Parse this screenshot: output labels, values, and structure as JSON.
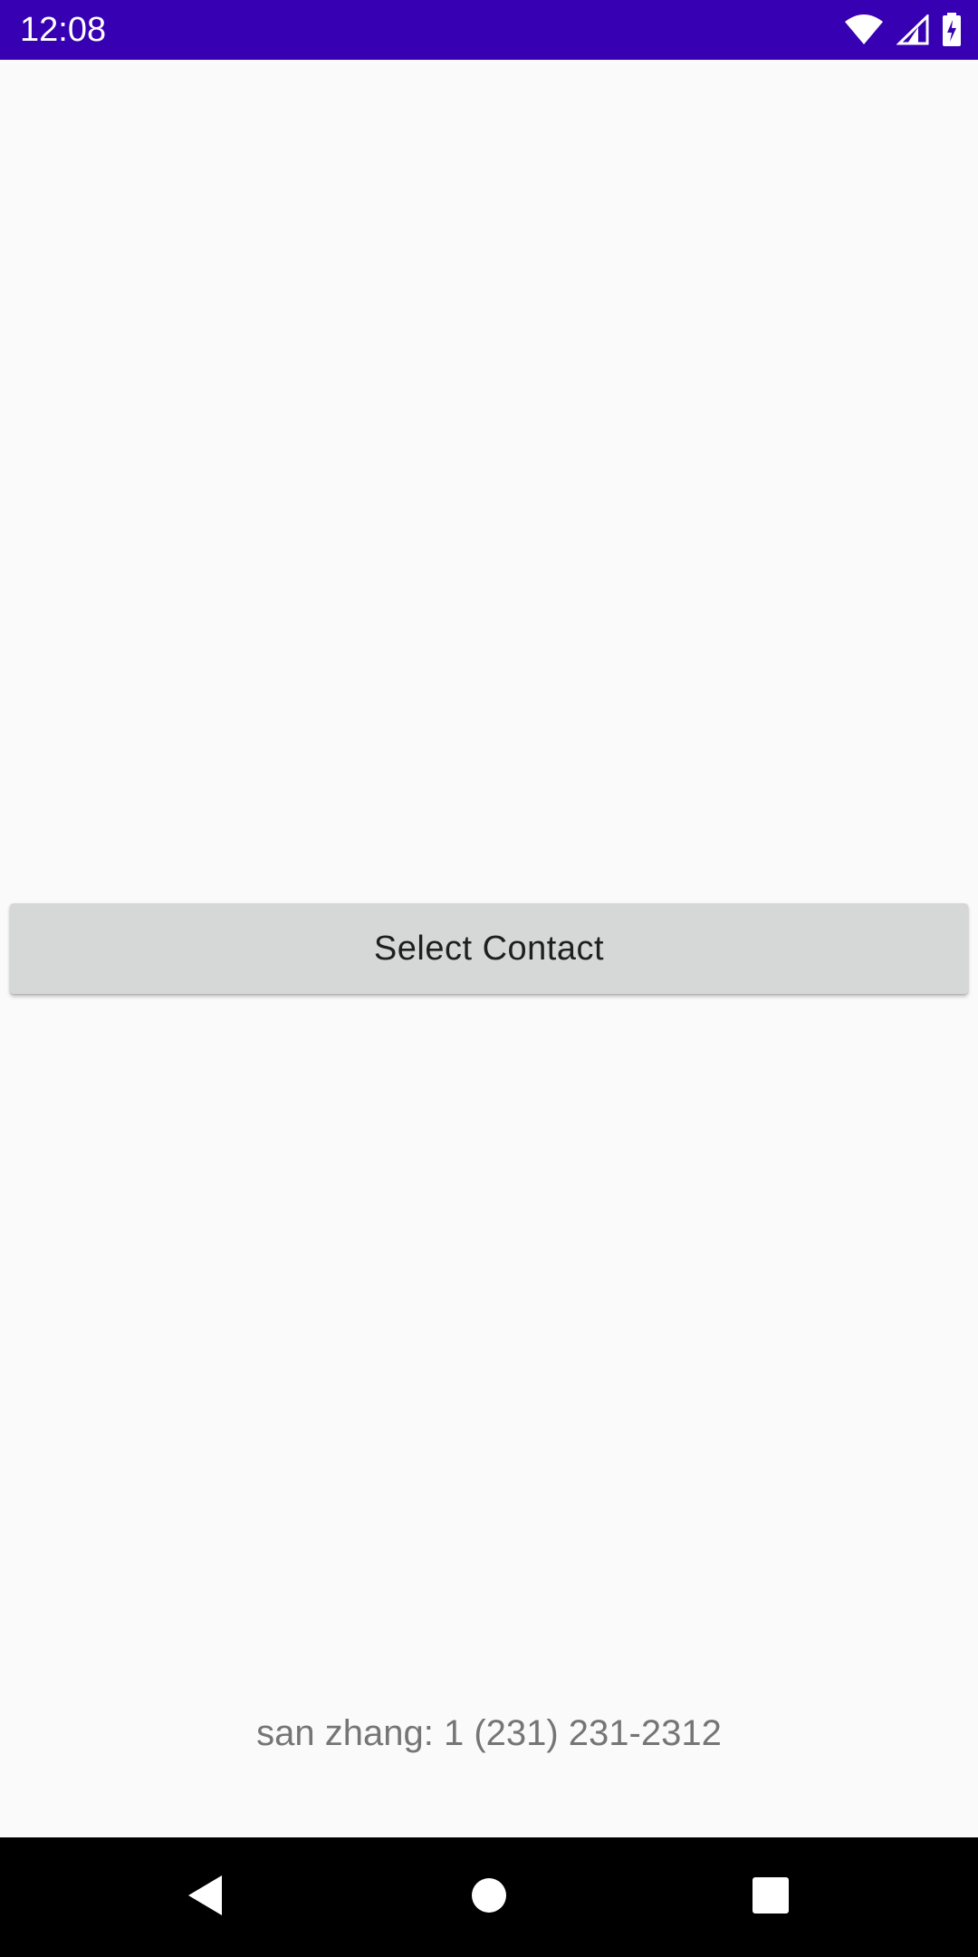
{
  "status_bar": {
    "time": "12:08",
    "background_color": "#3700b3",
    "icons": [
      "wifi-icon",
      "cellular-signal-icon",
      "battery-charging-icon"
    ]
  },
  "main": {
    "select_contact_button_label": "Select Contact",
    "contact_result_text": "san zhang: 1 (231) 231-2312"
  },
  "navigation_bar": {
    "buttons": [
      "back-icon",
      "home-icon",
      "recents-icon"
    ]
  }
}
